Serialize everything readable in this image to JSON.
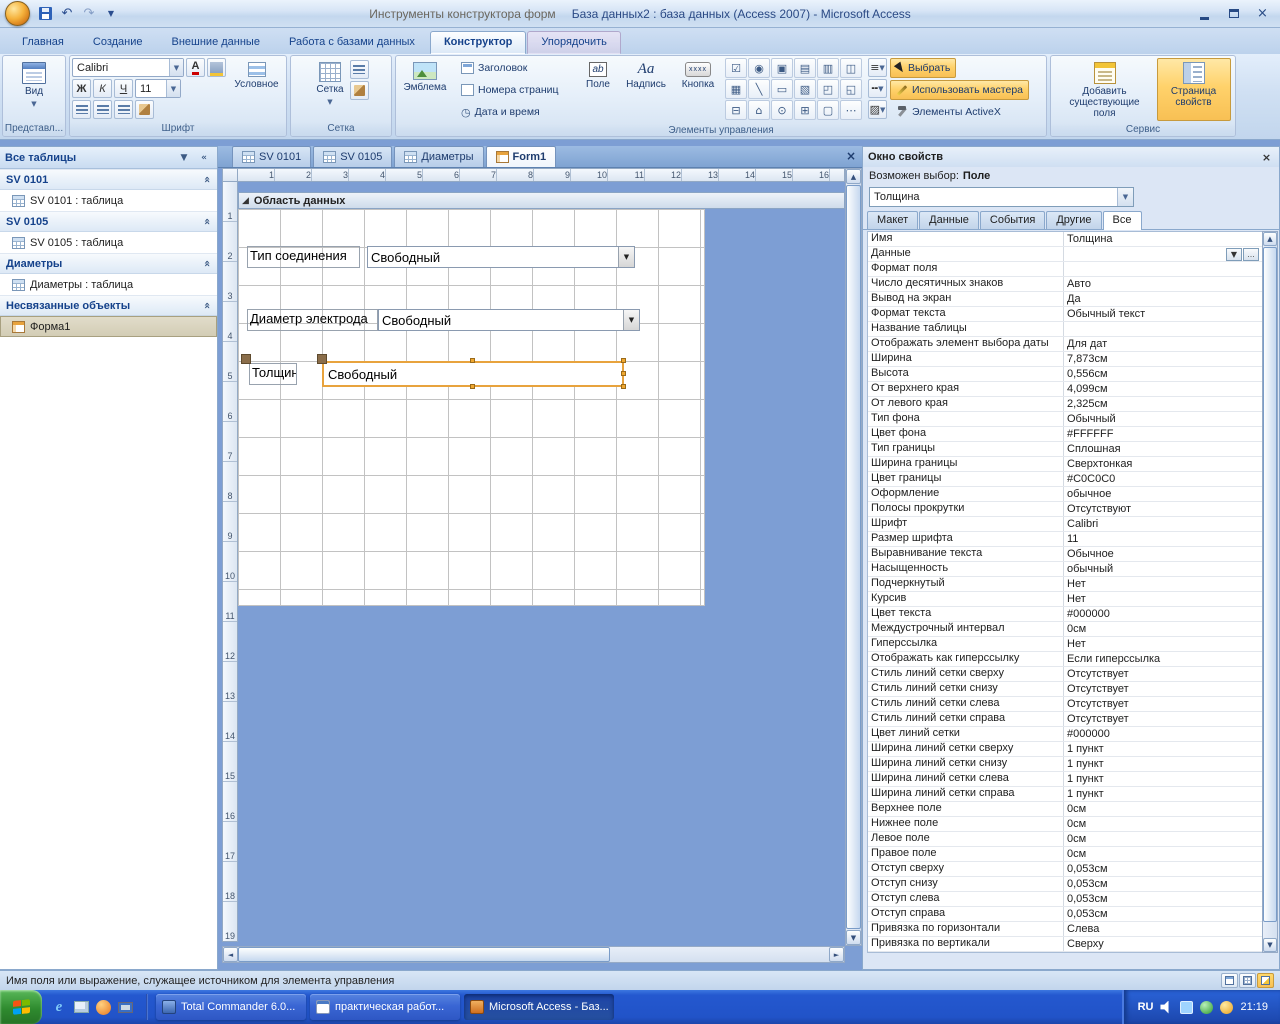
{
  "colors": {
    "selection_accent": "#E8A33D",
    "ribbon_highlight": "#FFD96A",
    "design_background": "#7D9ED4",
    "taskbar_blue": "#2458CF"
  },
  "titlebar": {
    "contextual_title": "Инструменты конструктора форм",
    "title": "База данных2 : база данных (Access 2007)  -  Microsoft Access"
  },
  "ribbon_tabs": [
    {
      "label": "Главная",
      "cls": ""
    },
    {
      "label": "Создание",
      "cls": ""
    },
    {
      "label": "Внешние данные",
      "cls": ""
    },
    {
      "label": "Работа с базами данных",
      "cls": ""
    },
    {
      "label": "Конструктор",
      "cls": "active"
    },
    {
      "label": "Упорядочить",
      "cls": "contextual"
    }
  ],
  "ribbon": {
    "views": {
      "label": "Представл...",
      "view": "Вид"
    },
    "font": {
      "label": "Шрифт",
      "family": "Calibri",
      "size": "11",
      "bold": "Ж",
      "italic": "К",
      "underline": "Ч",
      "conditional": "Условное"
    },
    "grid": {
      "label": "Сетка",
      "grid": "Сетка"
    },
    "controls": {
      "label": "Элементы управления",
      "logo": "Эмблема",
      "title": "Заголовок",
      "page_numbers": "Номера страниц",
      "date_time": "Дата и время",
      "field": "Поле",
      "field_glyph": "ab",
      "caption": "Надпись",
      "caption_glyph": "Aa",
      "button": "Кнопка",
      "button_glyph": "xxxx",
      "select": "Выбрать",
      "wizards": "Использовать мастера",
      "activex": "Элементы ActiveX"
    },
    "tools": {
      "label": "Сервис",
      "add_fields": "Добавить существующие поля",
      "property_sheet": "Страница свойств"
    }
  },
  "control_icons": [
    {
      "name": "check-box-icon",
      "glyph": "☑"
    },
    {
      "name": "option-button-icon",
      "glyph": "◉"
    },
    {
      "name": "toggle-button-icon",
      "glyph": "▣"
    },
    {
      "name": "combo-box-icon",
      "glyph": "▤"
    },
    {
      "name": "list-box-icon",
      "glyph": "▥"
    },
    {
      "name": "tab-control-icon",
      "glyph": "◫"
    },
    {
      "name": "chart-icon",
      "glyph": "▦"
    },
    {
      "name": "line-icon",
      "glyph": "╲"
    },
    {
      "name": "rectangle-icon",
      "glyph": "▭"
    },
    {
      "name": "image-icon",
      "glyph": "▧"
    },
    {
      "name": "bound-object-frame-icon",
      "glyph": "◰"
    },
    {
      "name": "unbound-object-frame-icon",
      "glyph": "◱"
    },
    {
      "name": "page-break-icon",
      "glyph": "⊟"
    },
    {
      "name": "hyperlink-icon",
      "glyph": "⌂"
    },
    {
      "name": "attachment-icon",
      "glyph": "⊙"
    },
    {
      "name": "subform-icon",
      "glyph": "⊞"
    },
    {
      "name": "option-group-icon",
      "glyph": "▢"
    },
    {
      "name": "more-controls-icon",
      "glyph": "⋯"
    }
  ],
  "line_buttons": [
    {
      "name": "line-thickness-button",
      "glyph": "≡"
    },
    {
      "name": "line-style-button",
      "glyph": "╍"
    },
    {
      "name": "special-effect-button",
      "glyph": "▨"
    }
  ],
  "sidebar": {
    "title": "Все таблицы",
    "rows": [
      {
        "cls": "group-header",
        "label": "SV 0101",
        "icon": "",
        "icon_name": "group-header"
      },
      {
        "cls": "item",
        "label": "SV 0101 : таблица",
        "icon": "table",
        "icon_name": "table-icon"
      },
      {
        "cls": "group-header",
        "label": "SV 0105",
        "icon": "",
        "icon_name": "group-header"
      },
      {
        "cls": "item",
        "label": "SV 0105 : таблица",
        "icon": "table",
        "icon_name": "table-icon"
      },
      {
        "cls": "group-header",
        "label": "Диаметры",
        "icon": "",
        "icon_name": "group-header"
      },
      {
        "cls": "item",
        "label": "Диаметры : таблица",
        "icon": "table",
        "icon_name": "table-icon"
      },
      {
        "cls": "group-header",
        "label": "Несвязанные объекты",
        "icon": "",
        "icon_name": "group-header"
      },
      {
        "cls": "item selected",
        "label": "Форма1",
        "icon": "form",
        "icon_name": "form-icon"
      }
    ]
  },
  "document": {
    "tabs": [
      {
        "label": "SV 0101",
        "cls": "",
        "icon": "tbl",
        "icon_name": "table-icon"
      },
      {
        "label": "SV 0105",
        "cls": "",
        "icon": "tbl",
        "icon_name": "table-icon"
      },
      {
        "label": "Диаметры",
        "cls": "",
        "icon": "tbl",
        "icon_name": "table-icon"
      },
      {
        "label": "Form1",
        "cls": "active",
        "icon": "frm",
        "icon_name": "form-icon"
      }
    ],
    "section_header": "Область данных",
    "h_ticks": [
      "1",
      "2",
      "3",
      "4",
      "5",
      "6",
      "7",
      "8",
      "9",
      "10",
      "11",
      "12",
      "13",
      "14",
      "15",
      "16"
    ],
    "v_ticks": [
      "1",
      "2",
      "3",
      "4",
      "5",
      "6",
      "7",
      "8",
      "9",
      "10",
      "11",
      "12",
      "13",
      "14",
      "15",
      "16",
      "17",
      "18",
      "19"
    ],
    "controls": [
      {
        "label": "Тип соединения",
        "value": "Свободный"
      },
      {
        "label": "Диаметр электрода",
        "value": "Свободный"
      },
      {
        "label": "Толщин",
        "value": "Свободный"
      }
    ]
  },
  "properties": {
    "window_title": "Окно свойств",
    "hint": "Возможен выбор:",
    "hint_type": "Поле",
    "selector": "Толщина",
    "tabs": [
      {
        "label": "Макет",
        "cls": ""
      },
      {
        "label": "Данные",
        "cls": ""
      },
      {
        "label": "События",
        "cls": ""
      },
      {
        "label": "Другие",
        "cls": ""
      },
      {
        "label": "Все",
        "cls": "active"
      }
    ],
    "rows": [
      {
        "name": "Имя",
        "value": "Толщина",
        "ed": ""
      },
      {
        "name": "Данные",
        "value": "",
        "ed": "data-editor"
      },
      {
        "name": "Формат поля",
        "value": "",
        "ed": ""
      },
      {
        "name": "Число десятичных знаков",
        "value": "Авто",
        "ed": ""
      },
      {
        "name": "Вывод на экран",
        "value": "Да",
        "ed": ""
      },
      {
        "name": "Формат текста",
        "value": "Обычный текст",
        "ed": ""
      },
      {
        "name": "Название таблицы",
        "value": "",
        "ed": ""
      },
      {
        "name": "Отображать элемент выбора даты",
        "value": "Для дат",
        "ed": ""
      },
      {
        "name": "Ширина",
        "value": "7,873см",
        "ed": ""
      },
      {
        "name": "Высота",
        "value": "0,556см",
        "ed": ""
      },
      {
        "name": "От верхнего края",
        "value": "4,099см",
        "ed": ""
      },
      {
        "name": "От левого края",
        "value": "2,325см",
        "ed": ""
      },
      {
        "name": "Тип фона",
        "value": "Обычный",
        "ed": ""
      },
      {
        "name": "Цвет фона",
        "value": "#FFFFFF",
        "ed": ""
      },
      {
        "name": "Тип границы",
        "value": "Сплошная",
        "ed": ""
      },
      {
        "name": "Ширина границы",
        "value": "Сверхтонкая",
        "ed": ""
      },
      {
        "name": "Цвет границы",
        "value": "#C0C0C0",
        "ed": ""
      },
      {
        "name": "Оформление",
        "value": "обычное",
        "ed": ""
      },
      {
        "name": "Полосы прокрутки",
        "value": "Отсутствуют",
        "ed": ""
      },
      {
        "name": "Шрифт",
        "value": "Calibri",
        "ed": ""
      },
      {
        "name": "Размер шрифта",
        "value": "11",
        "ed": ""
      },
      {
        "name": "Выравнивание текста",
        "value": "Обычное",
        "ed": ""
      },
      {
        "name": "Насыщенность",
        "value": "обычный",
        "ed": ""
      },
      {
        "name": "Подчеркнутый",
        "value": "Нет",
        "ed": ""
      },
      {
        "name": "Курсив",
        "value": "Нет",
        "ed": ""
      },
      {
        "name": "Цвет текста",
        "value": "#000000",
        "ed": ""
      },
      {
        "name": "Междустрочный интервал",
        "value": "0см",
        "ed": ""
      },
      {
        "name": "Гиперссылка",
        "value": "Нет",
        "ed": ""
      },
      {
        "name": "Отображать как гиперссылку",
        "value": "Если гиперссылка",
        "ed": ""
      },
      {
        "name": "Стиль линий сетки сверху",
        "value": "Отсутствует",
        "ed": ""
      },
      {
        "name": "Стиль линий сетки снизу",
        "value": "Отсутствует",
        "ed": ""
      },
      {
        "name": "Стиль линий сетки слева",
        "value": "Отсутствует",
        "ed": ""
      },
      {
        "name": "Стиль линий сетки справа",
        "value": "Отсутствует",
        "ed": ""
      },
      {
        "name": "Цвет линий сетки",
        "value": "#000000",
        "ed": ""
      },
      {
        "name": "Ширина линий сетки сверху",
        "value": "1 пункт",
        "ed": ""
      },
      {
        "name": "Ширина линий сетки снизу",
        "value": "1 пункт",
        "ed": ""
      },
      {
        "name": "Ширина линий сетки слева",
        "value": "1 пункт",
        "ed": ""
      },
      {
        "name": "Ширина линий сетки справа",
        "value": "1 пункт",
        "ed": ""
      },
      {
        "name": "Верхнее поле",
        "value": "0см",
        "ed": ""
      },
      {
        "name": "Нижнее поле",
        "value": "0см",
        "ed": ""
      },
      {
        "name": "Левое поле",
        "value": "0см",
        "ed": ""
      },
      {
        "name": "Правое поле",
        "value": "0см",
        "ed": ""
      },
      {
        "name": "Отступ сверху",
        "value": "0,053см",
        "ed": ""
      },
      {
        "name": "Отступ снизу",
        "value": "0,053см",
        "ed": ""
      },
      {
        "name": "Отступ слева",
        "value": "0,053см",
        "ed": ""
      },
      {
        "name": "Отступ справа",
        "value": "0,053см",
        "ed": ""
      },
      {
        "name": "Привязка по горизонтали",
        "value": "Слева",
        "ed": ""
      },
      {
        "name": "Привязка по вертикали",
        "value": "Сверху",
        "ed": ""
      }
    ]
  },
  "statusbar": {
    "text": "Имя поля или выражение, служащее источником для элемента управления"
  },
  "taskbar": {
    "tasks": [
      {
        "label": "Total Commander 6.0...",
        "cls": "",
        "icon": "tc",
        "icon_name": "total-commander-icon"
      },
      {
        "label": "практическая работ...",
        "cls": "",
        "icon": "doc",
        "icon_name": "word-document-icon"
      },
      {
        "label": "Microsoft Access - Баз...",
        "cls": "active",
        "icon": "acc",
        "icon_name": "access-icon"
      }
    ],
    "lang": "RU",
    "clock": "21:19"
  }
}
